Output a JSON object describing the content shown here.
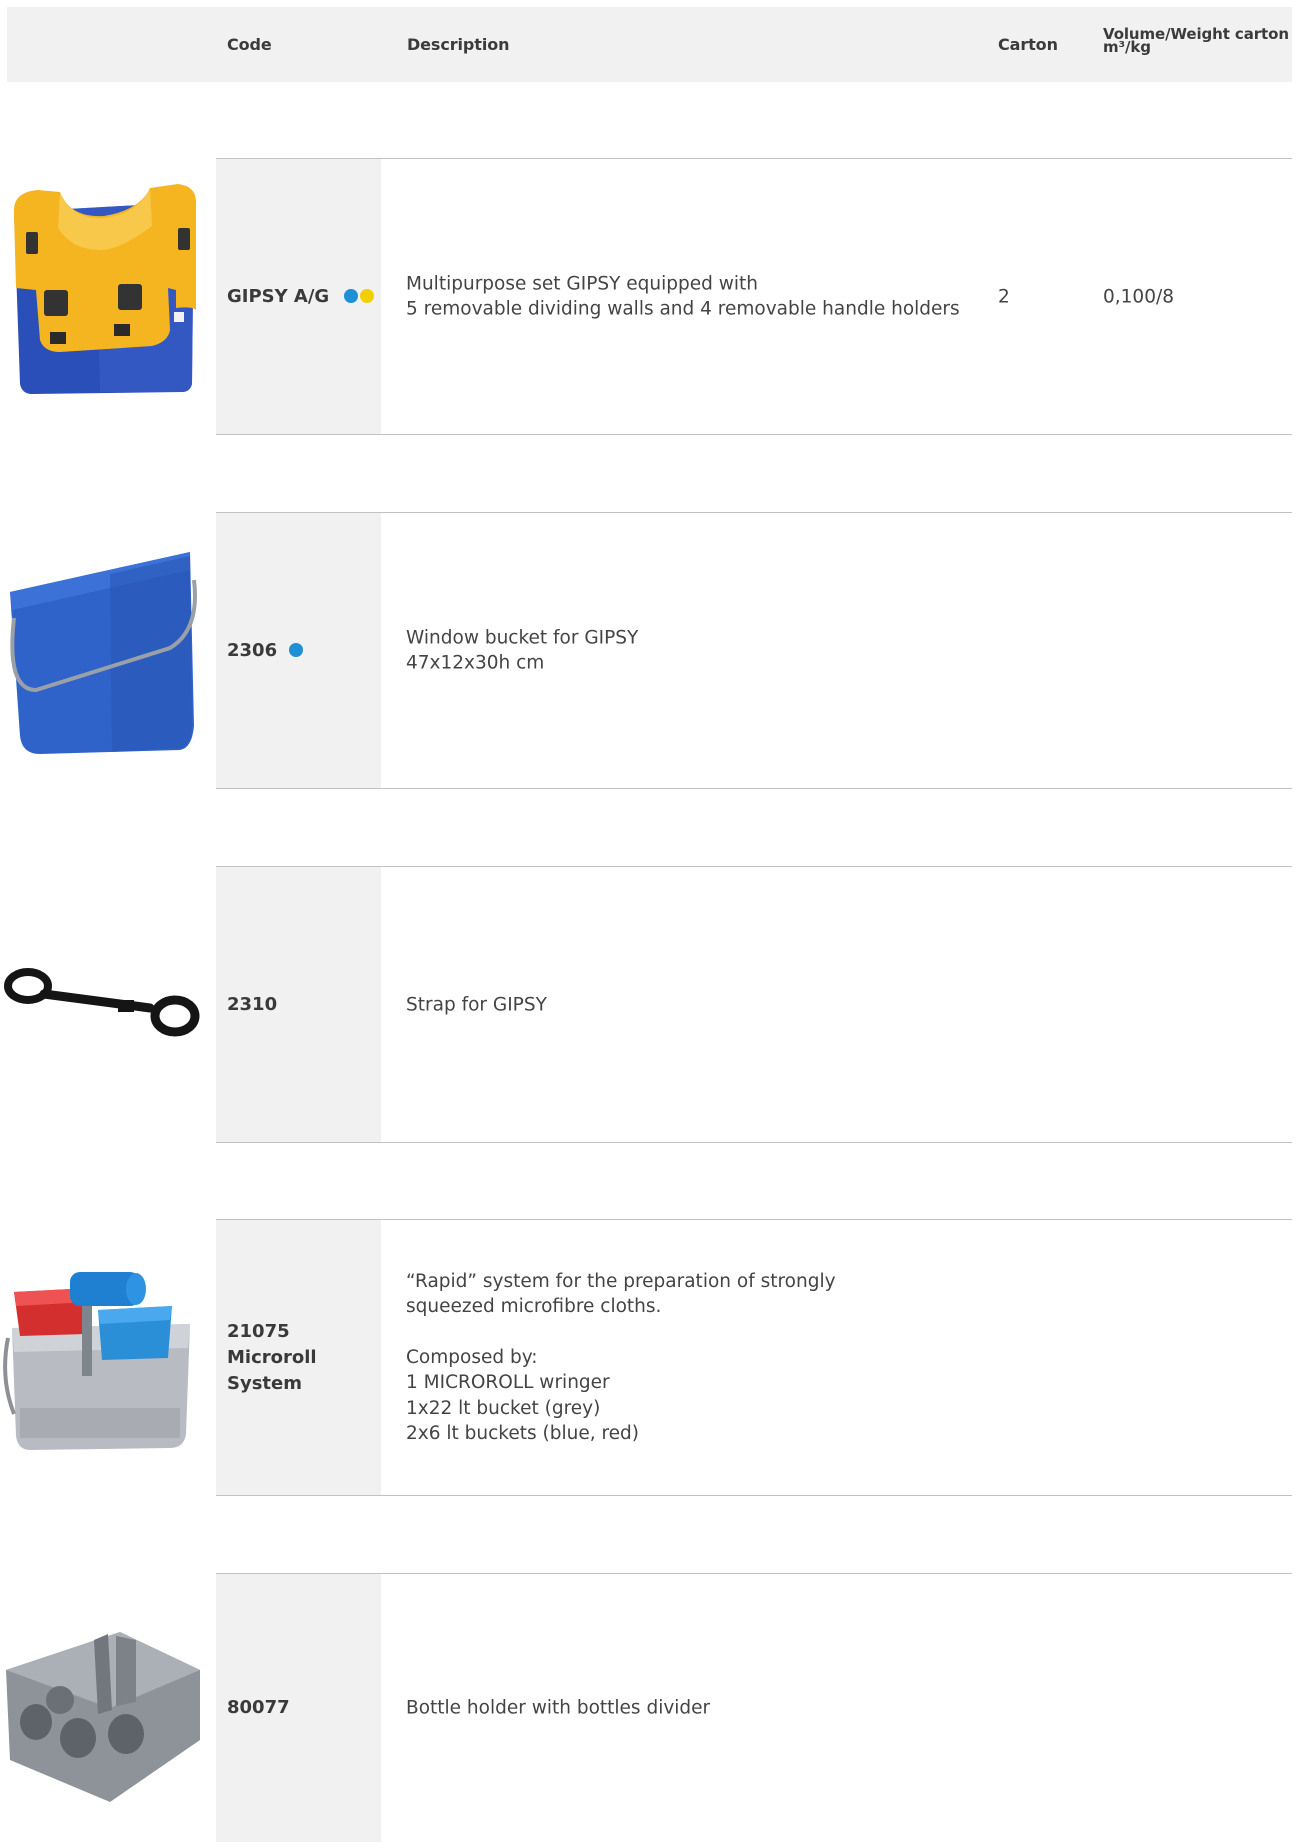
{
  "header": {
    "code": "Code",
    "description": "Description",
    "carton": "Carton",
    "volume_line1": "Volume/Weight carton",
    "volume_line2": "m³/kg"
  },
  "colors": {
    "blue": "#1f8fd6",
    "yellow": "#f2cf00"
  },
  "products": [
    {
      "code_lines": [
        "GIPSY A/G"
      ],
      "dots": [
        "blue",
        "yellow"
      ],
      "description_lines": [
        "Multipurpose set GIPSY equipped with",
        "5 removable dividing walls and 4 removable handle holders"
      ],
      "carton": "2",
      "volume_weight": "0,100/8",
      "image": "yellow-blue-multipurpose-gipsy-set"
    },
    {
      "code_lines": [
        "2306"
      ],
      "dots": [
        "blue"
      ],
      "description_lines": [
        "Window bucket for GIPSY",
        "47x12x30h cm"
      ],
      "image": "blue-window-bucket"
    },
    {
      "code_lines": [
        "2310"
      ],
      "dots": [],
      "description_lines": [
        "Strap for GIPSY"
      ],
      "image": "black-strap"
    },
    {
      "code_lines": [
        "21075",
        "Microroll",
        "System"
      ],
      "dots": [],
      "description_lines": [
        "“Rapid” system for the preparation of strongly",
        "squeezed microfibre cloths.",
        "",
        "Composed by:",
        "1 MICROROLL wringer",
        "1x22 lt bucket (grey)",
        "2x6 lt buckets (blue, red)"
      ],
      "image": "microroll-system"
    },
    {
      "code_lines": [
        "80077"
      ],
      "dots": [],
      "description_lines": [
        "Bottle holder with bottles divider"
      ],
      "image": "grey-bottle-holder"
    }
  ]
}
